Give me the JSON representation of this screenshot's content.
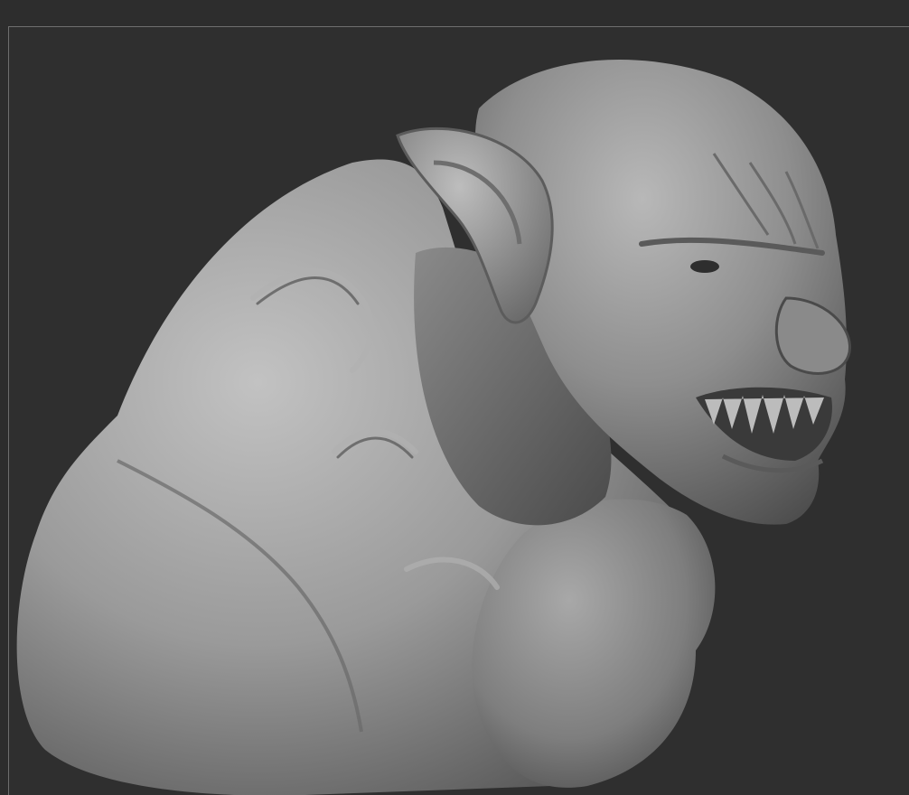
{
  "canvas": {
    "background_color": "#2f2f2f",
    "frame_color": "#6e6e6e",
    "material_base": "#8c8c8c",
    "material_light": "#c9c9c9",
    "material_shadow": "#3a3a3a"
  },
  "model": {
    "subject_icon": "sculpted-creature-bust-icon"
  }
}
